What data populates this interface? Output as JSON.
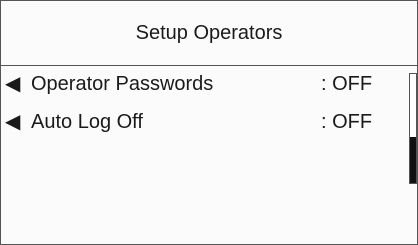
{
  "screen": {
    "title": "Setup Operators"
  },
  "menu": {
    "items": [
      {
        "arrow": "◀",
        "label": "Operator Passwords",
        "value": ": OFF"
      },
      {
        "arrow": "◀",
        "label": "Auto Log Off",
        "value": ": OFF"
      }
    ]
  },
  "scrollbar": {
    "thumb_start_fraction": 0.58,
    "thumb_end_fraction": 1.0
  },
  "colors": {
    "border": "#555555",
    "thumb": "#111111",
    "background": "#fbfbfb"
  },
  "icons": {
    "row_arrow": "left-pointer-triangle"
  }
}
